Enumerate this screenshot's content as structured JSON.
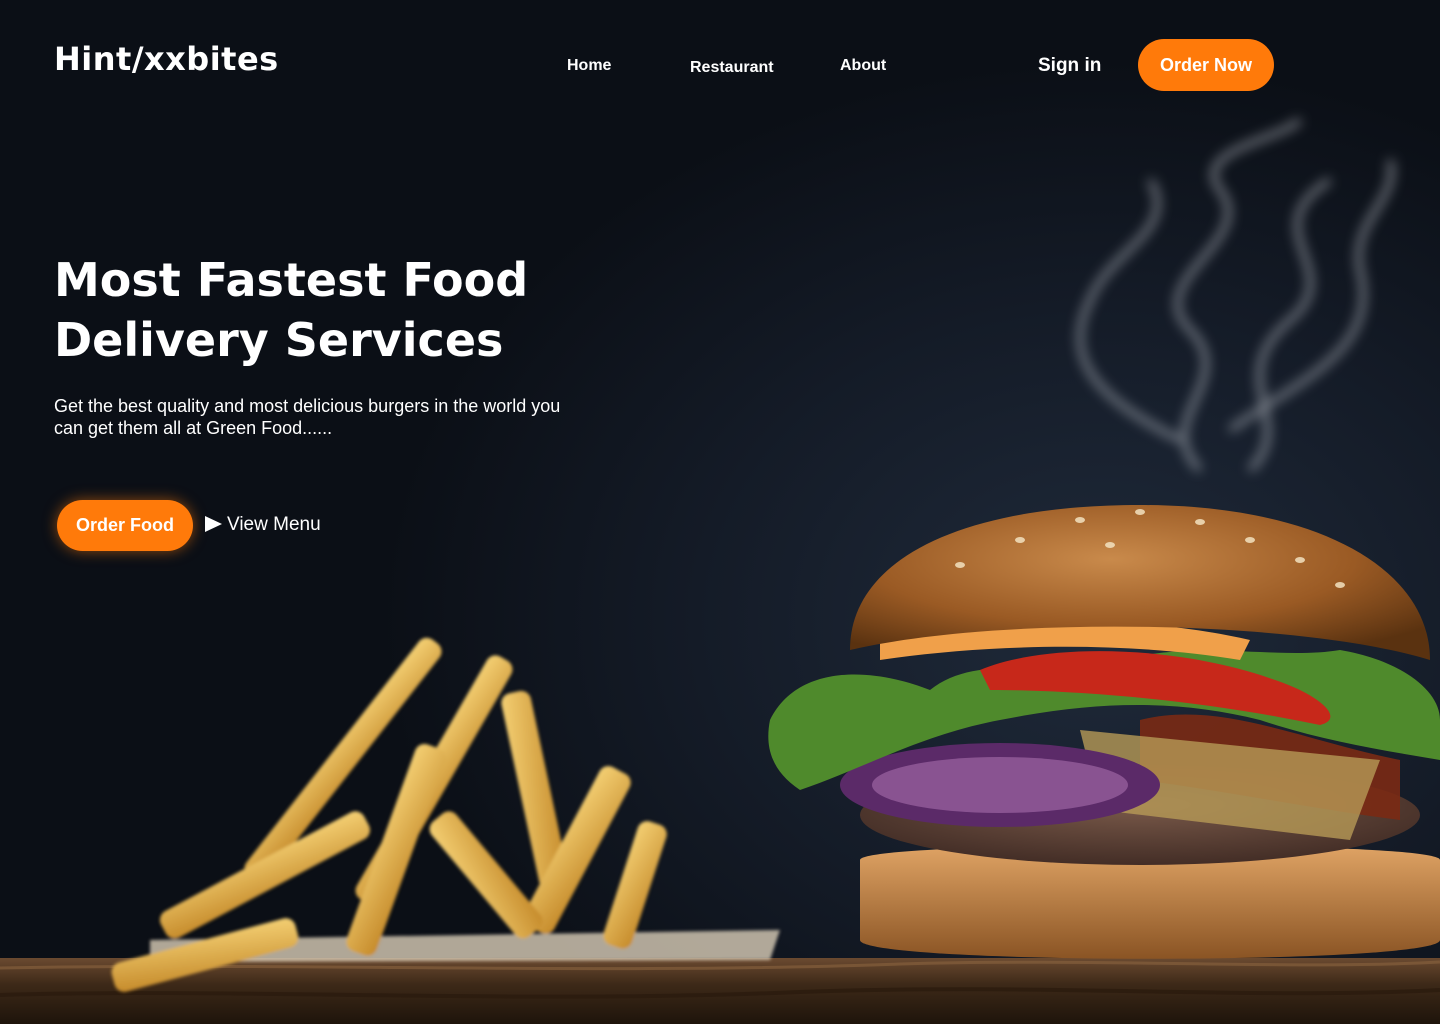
{
  "nav": {
    "logo": "Hint/xxbites",
    "links": [
      "Home",
      "Restaurant",
      "About"
    ],
    "sign_in": "Sign in",
    "order_now": "Order Now"
  },
  "hero": {
    "headline": "Most Fastest Food Delivery Services",
    "subtext": "Get the best quality and most delicious burgers in the world you can get them all at Green Food......",
    "order_food": "Order Food",
    "view_menu": "View Menu"
  },
  "images": {
    "burger": "burger-image",
    "fries": "french-fries-image",
    "smoke": "smoke-image",
    "board": "wooden-board-image"
  },
  "colors": {
    "accent": "#ff7a0a",
    "background": "#0b0f16",
    "text": "#ffffff"
  }
}
